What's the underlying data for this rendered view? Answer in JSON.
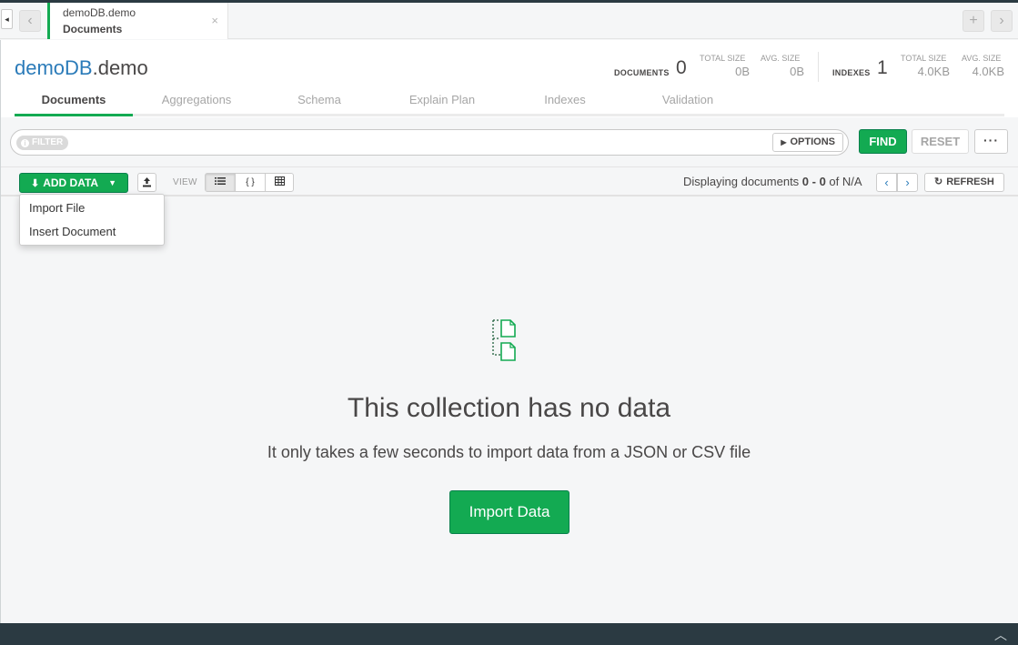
{
  "tab": {
    "namespace": "demoDB.demo",
    "title": "Documents",
    "close": "×",
    "new_tab": "+",
    "back": "‹",
    "forward": "›"
  },
  "header": {
    "db": "demoDB",
    "collection": ".demo",
    "stats": {
      "documents_label": "DOCUMENTS",
      "documents_count": "0",
      "doc_total_size_label": "TOTAL SIZE",
      "doc_total_size": "0B",
      "doc_avg_size_label": "AVG. SIZE",
      "doc_avg_size": "0B",
      "indexes_label": "INDEXES",
      "indexes_count": "1",
      "idx_total_size_label": "TOTAL SIZE",
      "idx_total_size": "4.0KB",
      "idx_avg_size_label": "AVG. SIZE",
      "idx_avg_size": "4.0KB"
    },
    "subtabs": [
      "Documents",
      "Aggregations",
      "Schema",
      "Explain Plan",
      "Indexes",
      "Validation"
    ]
  },
  "query": {
    "filter_label": "FILTER",
    "options_label": "OPTIONS",
    "find_label": "FIND",
    "reset_label": "RESET",
    "more_label": "···"
  },
  "toolbar": {
    "add_data_label": "ADD DATA",
    "view_label": "VIEW",
    "displaying_prefix": "Displaying documents ",
    "displaying_range": "0 - 0",
    "displaying_suffix": " of N/A",
    "refresh_label": "REFRESH"
  },
  "dropdown": {
    "items": [
      "Import File",
      "Insert Document"
    ]
  },
  "empty_state": {
    "title": "This collection has no data",
    "subtitle": "It only takes a few seconds to import data from a JSON or CSV file",
    "button": "Import Data"
  },
  "colors": {
    "accent_green": "#13aa52",
    "link_blue": "#2b7bb9",
    "dark_bar": "#2b3a42"
  }
}
